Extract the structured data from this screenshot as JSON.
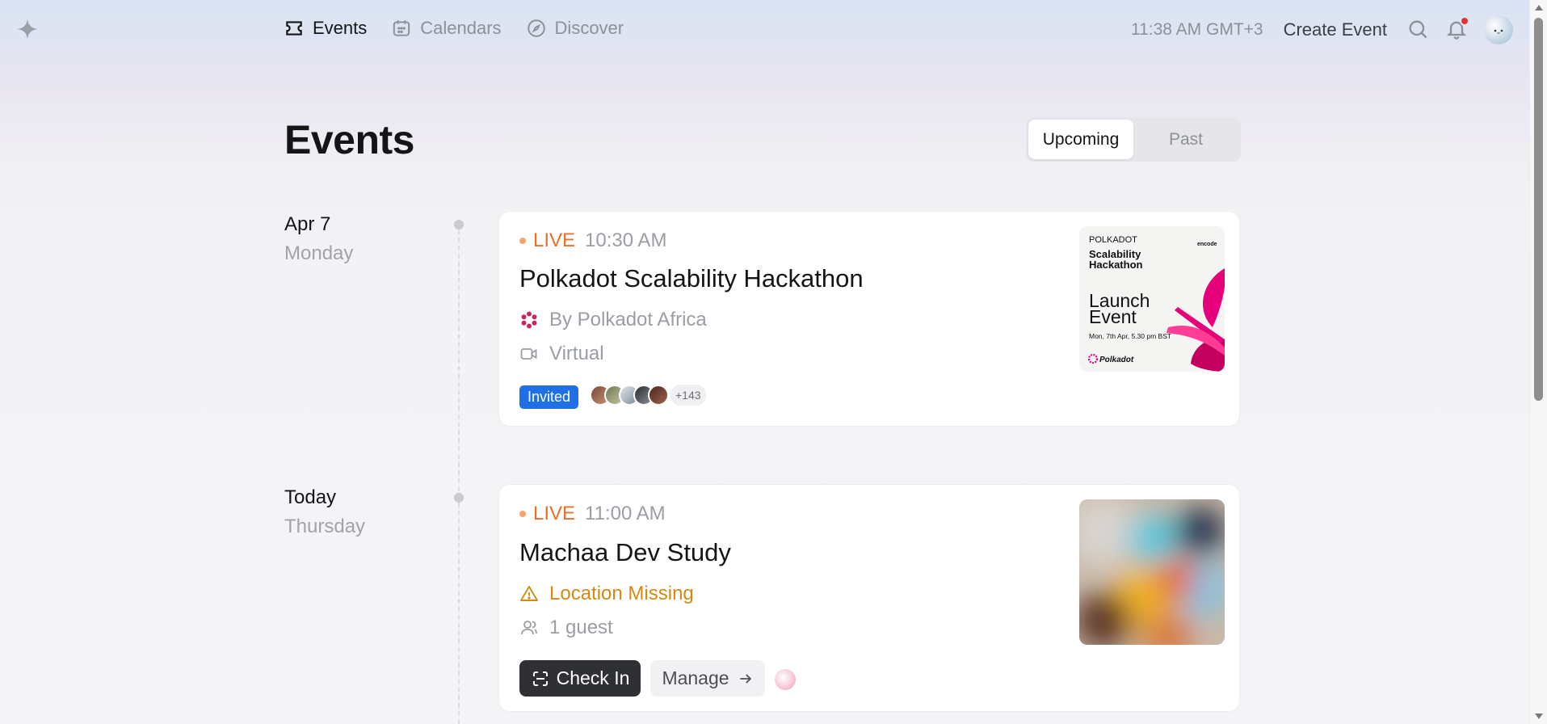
{
  "colors": {
    "accent_live": "#e8702a",
    "badge_blue": "#1f6fe6",
    "warning": "#d28a12",
    "notification": "#e63030"
  },
  "nav": {
    "items": [
      {
        "label": "Events",
        "icon": "ticket-icon",
        "active": true
      },
      {
        "label": "Calendars",
        "icon": "calendar-icon",
        "active": false
      },
      {
        "label": "Discover",
        "icon": "compass-icon",
        "active": false
      }
    ]
  },
  "topright": {
    "time": "11:38 AM GMT+3",
    "create_label": "Create Event"
  },
  "page": {
    "title": "Events",
    "tabs": [
      {
        "label": "Upcoming",
        "active": true
      },
      {
        "label": "Past",
        "active": false
      }
    ]
  },
  "groups": [
    {
      "date": "Apr 7",
      "weekday": "Monday",
      "event": {
        "live_label": "LIVE",
        "time": "10:30 AM",
        "title": "Polkadot Scalability Hackathon",
        "host": "By Polkadot Africa",
        "location": "Virtual",
        "badge": "Invited",
        "more_guests": "+143",
        "poster": {
          "brand": "POLKADOT",
          "subtitle_line1": "Scalability",
          "subtitle_line2": "Hackathon",
          "headline_line1": "Launch",
          "headline_line2": "Event",
          "date": "Mon, 7th Apr, 5.30 pm BST",
          "partner": "encode",
          "logo_text": "Polkadot"
        }
      }
    },
    {
      "date": "Today",
      "weekday": "Thursday",
      "event": {
        "live_label": "LIVE",
        "time": "11:00 AM",
        "title": "Machaa Dev Study",
        "warning": "Location Missing",
        "guests": "1 guest",
        "checkin_label": "Check In",
        "manage_label": "Manage"
      }
    }
  ]
}
